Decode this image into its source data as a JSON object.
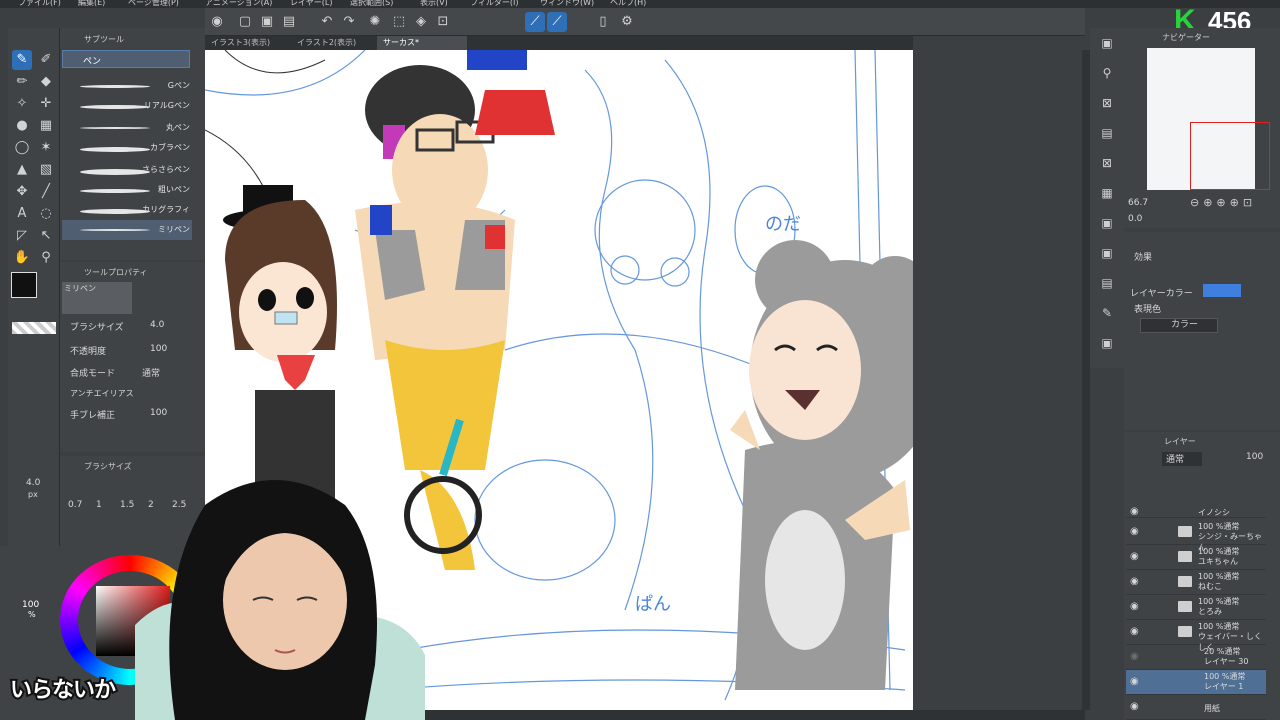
{
  "menu": [
    "ファイル(F)",
    "編集(E)",
    "ページ管理(P)",
    "アニメーション(A)",
    "レイヤー(L)",
    "選択範囲(S)",
    "表示(V)",
    "フィルター(I)",
    "ウィンドウ(W)",
    "ヘルプ(H)"
  ],
  "overlay": {
    "badge_letter": "K",
    "badge_count": "456",
    "caption": "いらないか"
  },
  "doc_tabs": [
    "イラスト3(表示)",
    "イラスト2(表示)",
    "サーカス*"
  ],
  "subtool": {
    "tab_label": "サブツール",
    "group_label": "ペン",
    "brushes": [
      "Gペン",
      "リアルGペン",
      "丸ペン",
      "カブラペン",
      "さらさらペン",
      "粗いペン",
      "カリグラフィ",
      "ミリペン"
    ],
    "selected_index": 7
  },
  "tool_property": {
    "title": "ツールプロパティ",
    "preset": "ミリペン",
    "brush_size_label": "ブラシサイズ",
    "brush_size_value": "4.0",
    "opacity_label": "不透明度",
    "opacity_value": "100",
    "blend_label": "合成モード",
    "blend_value": "通常",
    "antialias_label": "アンチエイリアス",
    "stabilizer_label": "手ブレ補正",
    "stabilizer_value": "100"
  },
  "brush_size_palette": {
    "title": "ブラシサイズ",
    "current": "4.0",
    "unit": "px",
    "sizes": [
      "0.7",
      "1",
      "1.5",
      "2",
      "2.5"
    ]
  },
  "color": {
    "opacity_value": "100",
    "opacity_unit": "%",
    "main": "#111111"
  },
  "navigator": {
    "title": "ナビゲーター",
    "zoom": "66.7",
    "rotation": "0.0"
  },
  "effect": {
    "title": "効果",
    "layer_color_label": "レイヤーカラー",
    "layer_color": "#3f7fe0",
    "expression_label": "表現色",
    "expression_value": "カラー"
  },
  "layers": {
    "title": "レイヤー",
    "blend": "通常",
    "opacity": "100",
    "items": [
      {
        "pct": "",
        "name": "イノシシ"
      },
      {
        "pct": "100 %通常",
        "name": "シンジ・みーちゃん"
      },
      {
        "pct": "100 %通常",
        "name": "ユキちゃん"
      },
      {
        "pct": "100 %通常",
        "name": "ねむこ"
      },
      {
        "pct": "100 %通常",
        "name": "とろみ"
      },
      {
        "pct": "100 %通常",
        "name": "ウェイバー・しくしく"
      },
      {
        "pct": "20 %通常",
        "name": "レイヤー 30"
      },
      {
        "pct": "100 %通常",
        "name": "レイヤー 1"
      },
      {
        "pct": "",
        "name": "用紙"
      }
    ]
  },
  "canvas_text": {
    "bubble": "のだ",
    "label": "ぱん"
  }
}
